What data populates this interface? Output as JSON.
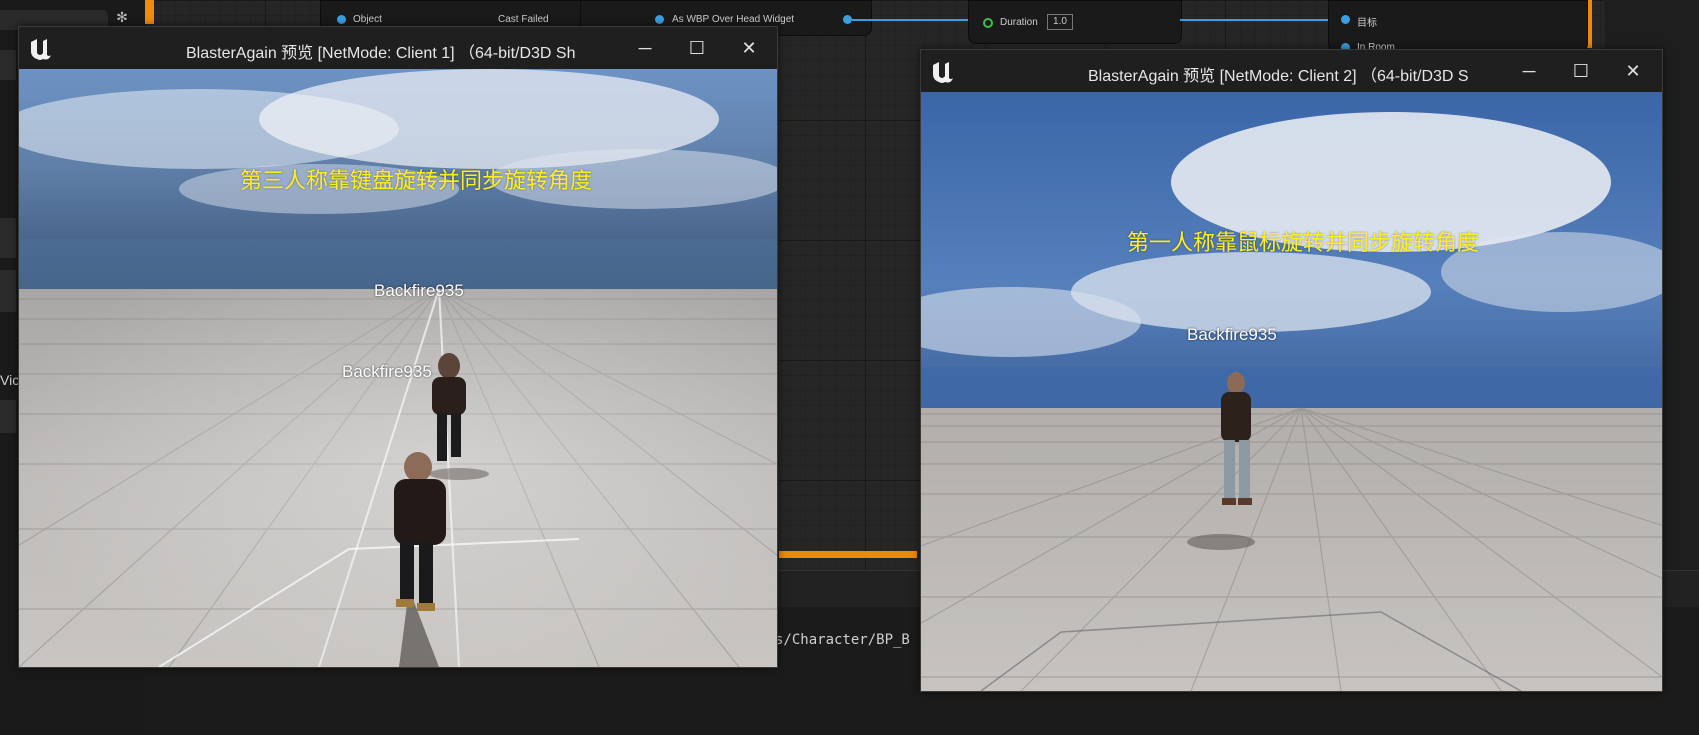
{
  "editor": {
    "node_object_pin": "Object",
    "node_cast_failed": "Cast Failed",
    "node_as_widget": "As WBP Over Head Widget",
    "node_duration": "Duration",
    "node_duration_value": "1.0",
    "node_target": "目标",
    "node_in_room": "In Room",
    "left_clip": "Vic",
    "asset_path": "s/Character/BP_B"
  },
  "client1": {
    "title": "BlasterAgain 预览 [NetMode: Client 1]  （64-bit/D3D Sh",
    "overlay": "第三人称靠键盘旋转并同步旋转角度",
    "name_far": "Backfire935",
    "name_near": "Backfire935"
  },
  "client2": {
    "title": "BlasterAgain 预览 [NetMode: Client 2]  （64-bit/D3D S",
    "overlay": "第一人称靠鼠标旋转并同步旋转角度",
    "name_char": "Backfire935"
  },
  "controls": {
    "minimize": "─",
    "maximize": "☐",
    "close": "✕"
  },
  "icons": {
    "logo": "unreal-engine-logo",
    "gear": "gear-icon"
  },
  "colors": {
    "overlay_text": "#ffee22",
    "accent_orange": "#ee8a0a",
    "wire_blue": "#3a9fe0"
  }
}
